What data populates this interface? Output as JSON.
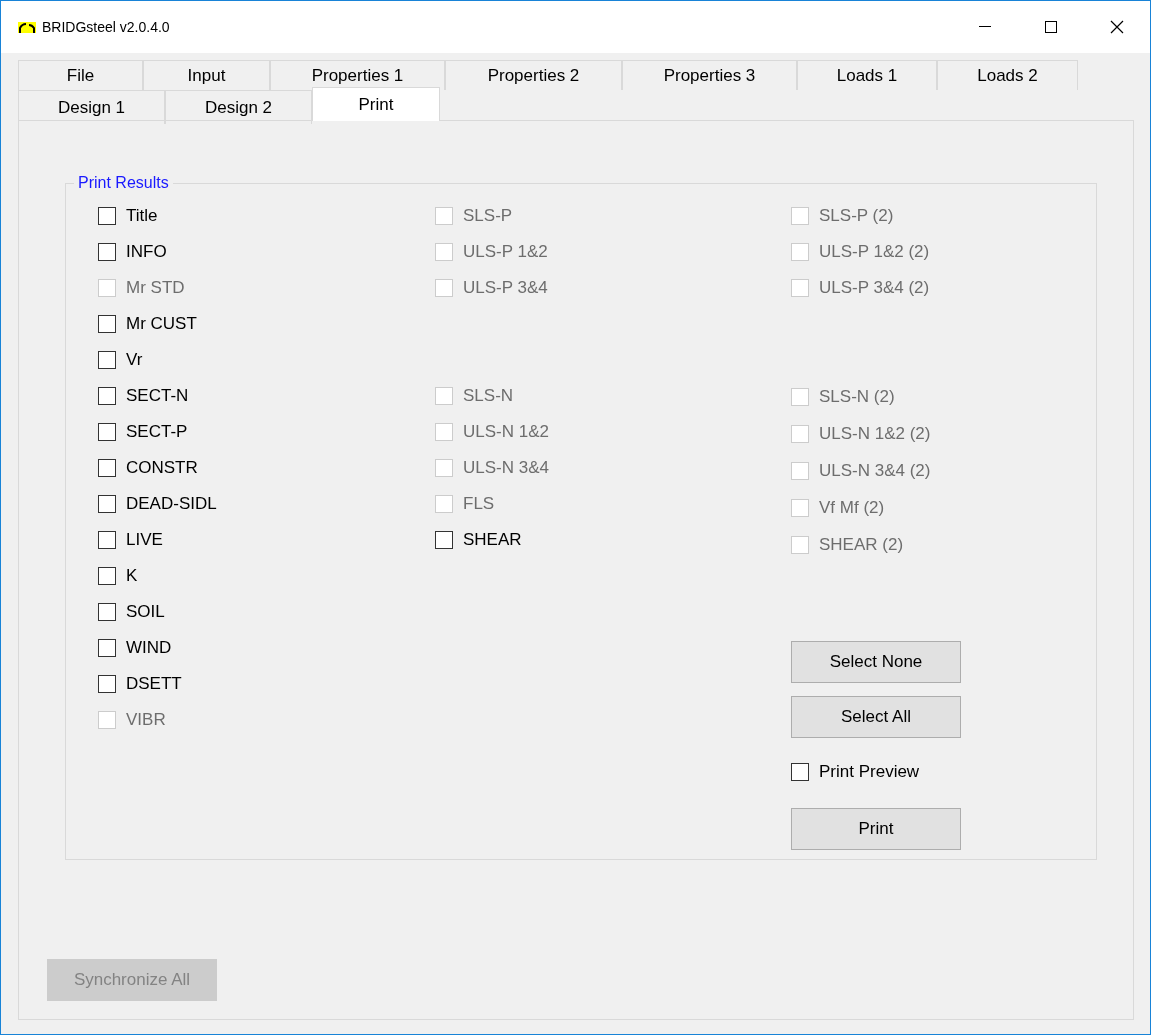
{
  "window": {
    "title": "BRIDGsteel v2.0.4.0"
  },
  "tab_rows": [
    [
      {
        "label": "File",
        "selected": false
      },
      {
        "label": "Input",
        "selected": false
      },
      {
        "label": "Properties 1",
        "selected": false
      },
      {
        "label": "Properties 2",
        "selected": false
      },
      {
        "label": "Properties 3",
        "selected": false
      },
      {
        "label": "Loads 1",
        "selected": false
      },
      {
        "label": "Loads 2",
        "selected": false
      }
    ],
    [
      {
        "label": "Design 1",
        "selected": false
      },
      {
        "label": "Design 2",
        "selected": false
      },
      {
        "label": "Print",
        "selected": true
      }
    ]
  ],
  "print_results": {
    "title": "Print Results",
    "columns": [
      {
        "groups": [
          [
            {
              "label": "Title",
              "checked": false,
              "disabled": false
            },
            {
              "label": "INFO",
              "checked": false,
              "disabled": false
            },
            {
              "label": "Mr STD",
              "checked": false,
              "disabled": true
            },
            {
              "label": "Mr CUST",
              "checked": false,
              "disabled": false
            },
            {
              "label": "Vr",
              "checked": false,
              "disabled": false
            },
            {
              "label": "SECT-N",
              "checked": false,
              "disabled": false
            },
            {
              "label": "SECT-P",
              "checked": false,
              "disabled": false
            },
            {
              "label": "CONSTR",
              "checked": false,
              "disabled": false
            },
            {
              "label": "DEAD-SIDL",
              "checked": false,
              "disabled": false
            },
            {
              "label": "LIVE",
              "checked": false,
              "disabled": false
            },
            {
              "label": "K",
              "checked": false,
              "disabled": false
            },
            {
              "label": "SOIL",
              "checked": false,
              "disabled": false
            },
            {
              "label": "WIND",
              "checked": false,
              "disabled": false
            },
            {
              "label": "DSETT",
              "checked": false,
              "disabled": false
            },
            {
              "label": "VIBR",
              "checked": false,
              "disabled": true
            }
          ]
        ]
      },
      {
        "groups": [
          [
            {
              "label": "SLS-P",
              "checked": false,
              "disabled": true
            },
            {
              "label": "ULS-P 1&2",
              "checked": false,
              "disabled": true
            },
            {
              "label": "ULS-P 3&4",
              "checked": false,
              "disabled": true
            }
          ],
          [
            {
              "label": "SLS-N",
              "checked": false,
              "disabled": true
            },
            {
              "label": "ULS-N 1&2",
              "checked": false,
              "disabled": true
            },
            {
              "label": "ULS-N 3&4",
              "checked": false,
              "disabled": true
            },
            {
              "label": "FLS",
              "checked": false,
              "disabled": true
            },
            {
              "label": "SHEAR",
              "checked": false,
              "disabled": false
            }
          ]
        ]
      },
      {
        "groups": [
          [
            {
              "label": "SLS-P (2)",
              "checked": false,
              "disabled": true
            },
            {
              "label": "ULS-P 1&2 (2)",
              "checked": false,
              "disabled": true
            },
            {
              "label": "ULS-P 3&4 (2)",
              "checked": false,
              "disabled": true
            }
          ],
          [
            {
              "label": "SLS-N (2)",
              "checked": false,
              "disabled": true
            },
            {
              "label": "ULS-N 1&2 (2)",
              "checked": false,
              "disabled": true
            },
            {
              "label": "ULS-N 3&4 (2)",
              "checked": false,
              "disabled": true
            },
            {
              "label": "Vf Mf (2)",
              "checked": false,
              "disabled": true
            },
            {
              "label": "SHEAR (2)",
              "checked": false,
              "disabled": true
            }
          ]
        ]
      }
    ],
    "select_none": {
      "label": "Select None",
      "disabled": false
    },
    "select_all": {
      "label": "Select All",
      "disabled": false
    },
    "print_preview": {
      "label": "Print Preview",
      "checked": false,
      "disabled": false
    },
    "print": {
      "label": "Print",
      "disabled": false
    }
  },
  "synchronize_all": {
    "label": "Synchronize All",
    "disabled": true
  }
}
